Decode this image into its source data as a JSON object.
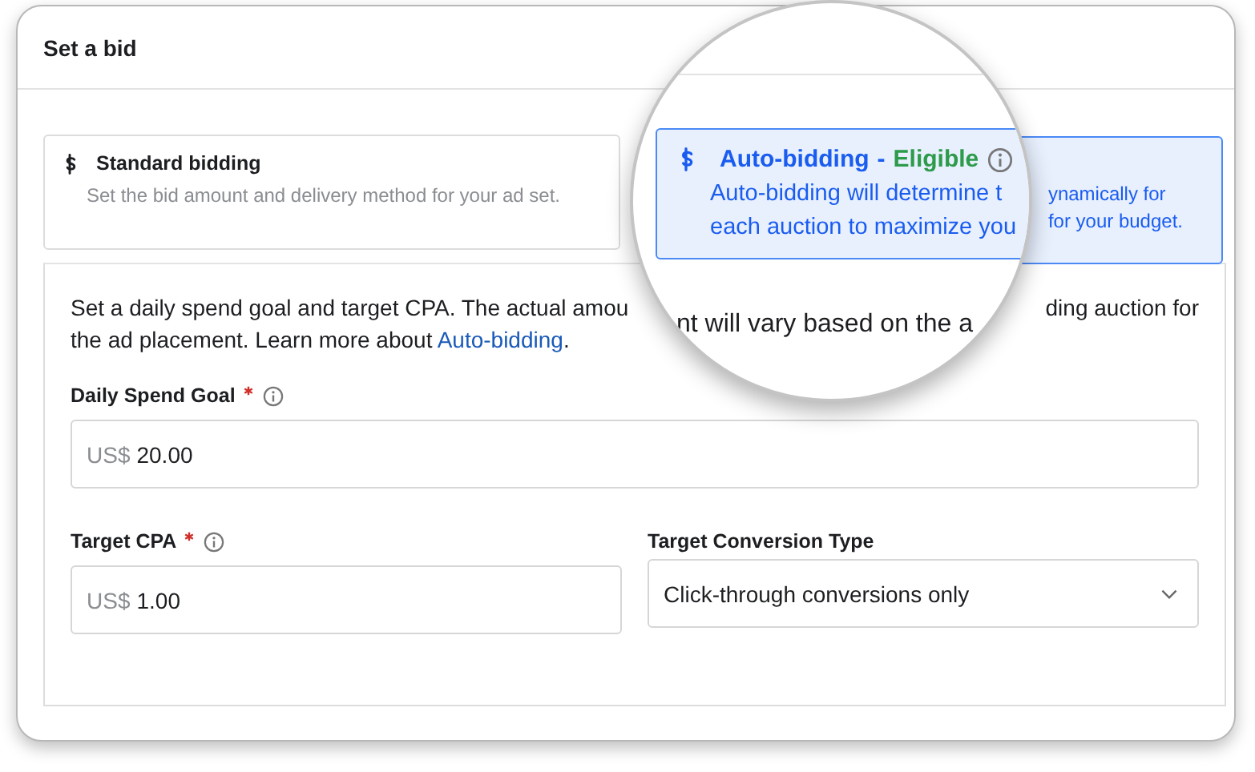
{
  "panel": {
    "title": "Set a bid"
  },
  "options": [
    {
      "kind": "standard",
      "selected": false,
      "title": "Standard bidding",
      "description_lines": [
        "Set the bid amount and delivery method for your ad set."
      ]
    },
    {
      "kind": "auto",
      "selected": true,
      "description_lines": [
        "ynamically for",
        "for your budget."
      ]
    }
  ],
  "intro": {
    "line_1_start": "Set a daily spend goal and target CPA. The actual amou",
    "line_1_end": "ding auction for",
    "line_2": "the ad placement. Learn more about",
    "link": "Auto-bidding",
    "line_2_end": "."
  },
  "fields": [
    {
      "kind": "input",
      "label": "Daily Spend Goal",
      "required": true,
      "info": true,
      "prefix": "US$",
      "value": "20.00"
    },
    {
      "kind": "input",
      "label": "Target CPA",
      "required": true,
      "info": true,
      "prefix": "US$",
      "value": "1.00"
    },
    {
      "kind": "select",
      "label": "Target Conversion Type",
      "required": false,
      "info": false,
      "value": "Click-through conversions only"
    }
  ],
  "magnifier": {
    "title": "Auto-bidding",
    "separator": "-",
    "status": "Eligible",
    "description_lines": [
      "Auto-bidding will determine t",
      "each auction to maximize you"
    ],
    "intro_fragment": "nt will vary based on the a"
  }
}
